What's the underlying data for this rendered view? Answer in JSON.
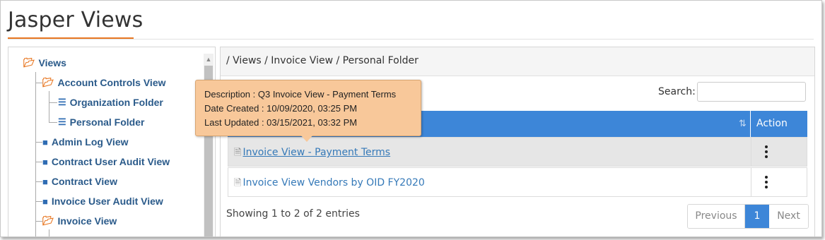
{
  "header": {
    "title": "Jasper Views"
  },
  "tree": {
    "root": "Views",
    "items": [
      {
        "label": "Account Controls View",
        "icon": "folder-open-icon"
      },
      {
        "label": "Organization Folder",
        "icon": "database-icon"
      },
      {
        "label": "Personal Folder",
        "icon": "database-icon"
      },
      {
        "label": "Admin Log View",
        "icon": "folder-icon"
      },
      {
        "label": "Contract User Audit View",
        "icon": "folder-icon"
      },
      {
        "label": "Contract View",
        "icon": "folder-icon"
      },
      {
        "label": "Invoice User Audit View",
        "icon": "folder-icon"
      },
      {
        "label": "Invoice View",
        "icon": "folder-open-icon"
      }
    ]
  },
  "breadcrumb": "/ Views / Invoice View / Personal Folder",
  "search": {
    "label": "Search:",
    "value": "",
    "placeholder": ""
  },
  "table": {
    "action_header": "Action",
    "rows": [
      {
        "name": "Invoice View - Payment Terms"
      },
      {
        "name": "Invoice View Vendors by OID FY2020"
      }
    ]
  },
  "tooltip": {
    "description": "Description : Q3 Invoice View - Payment Terms",
    "created": "Date Created : 10/09/2020, 03:25 PM",
    "updated": "Last Updated : 03/15/2021, 03:32 PM"
  },
  "footer": {
    "info": "Showing 1 to 2 of 2 entries",
    "previous": "Previous",
    "page": "1",
    "next": "Next"
  },
  "colors": {
    "accent": "#e87722",
    "primary": "#3d86d8",
    "link": "#3579b8",
    "tooltip_bg": "#f8c89a"
  }
}
